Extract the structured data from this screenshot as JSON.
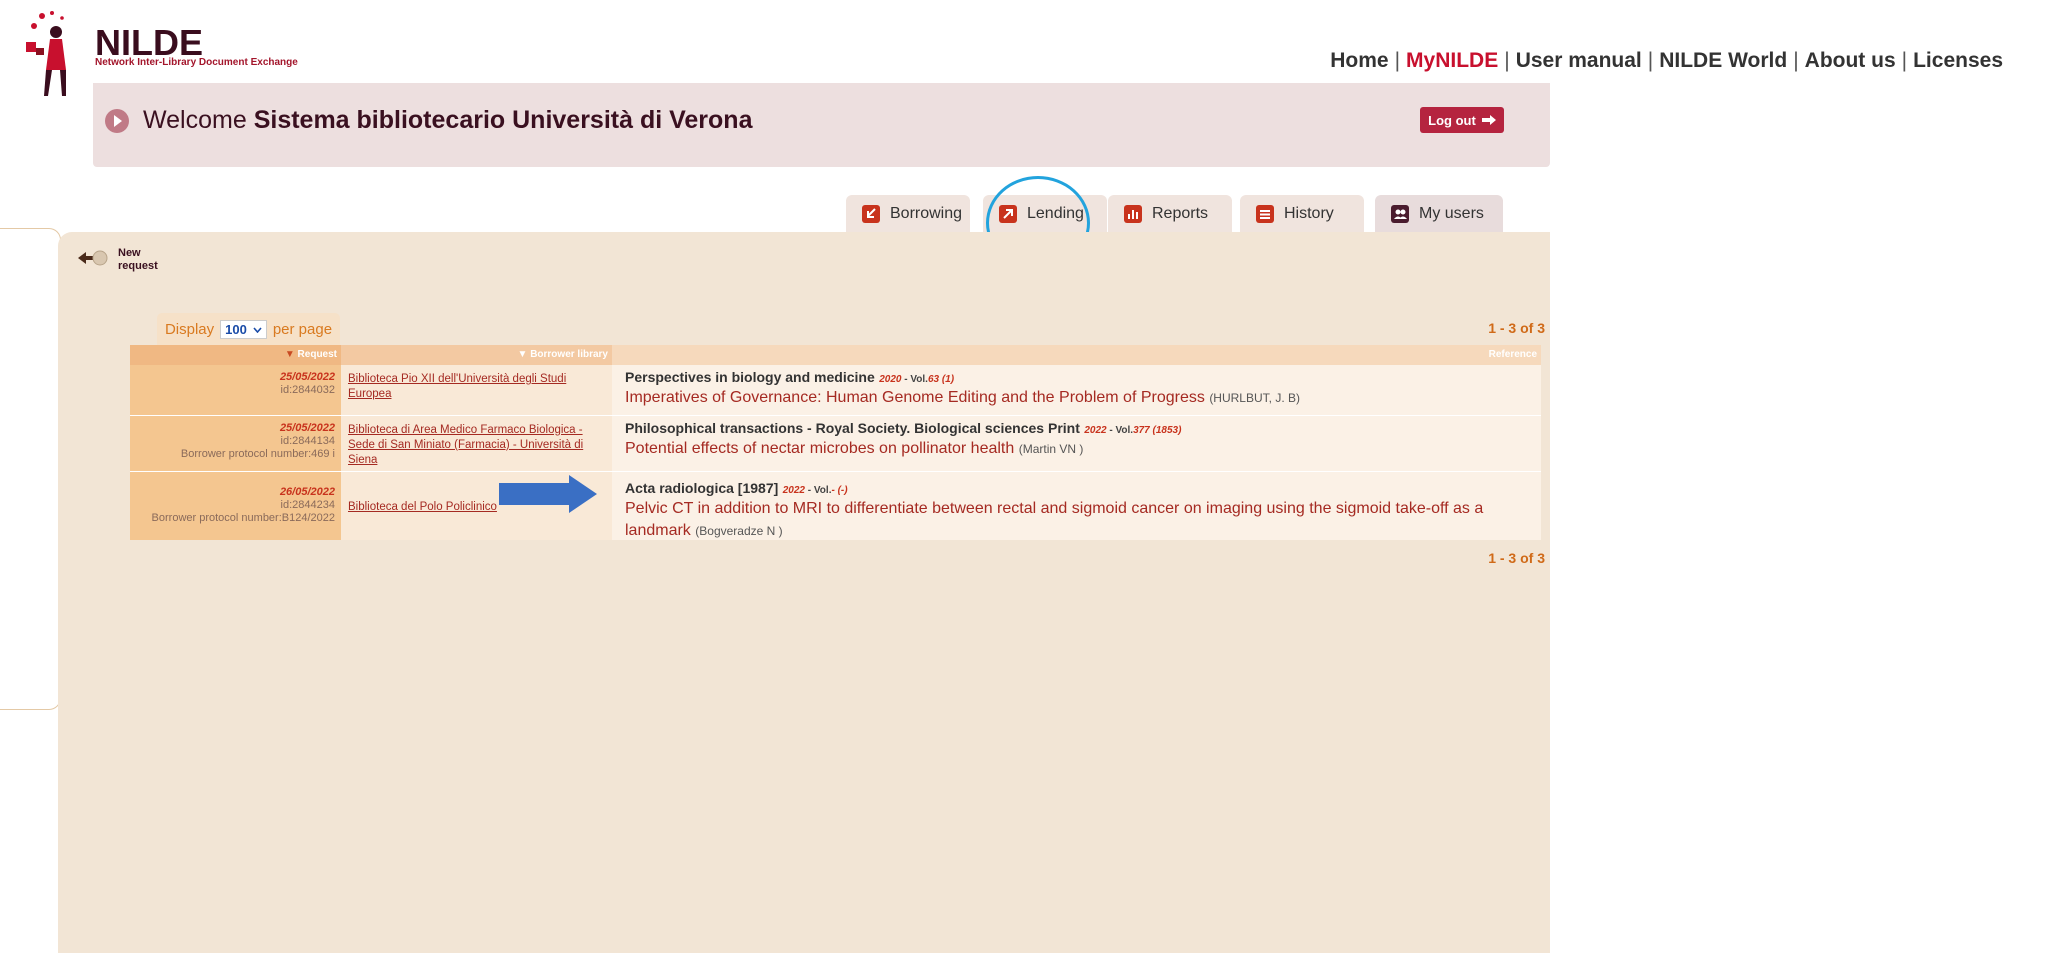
{
  "header": {
    "logo_title": "NILDE",
    "logo_subtitle": "Network Inter-Library Document Exchange",
    "nav": [
      {
        "label": "Home",
        "active": false
      },
      {
        "label": "MyNILDE",
        "active": true
      },
      {
        "label": "User manual",
        "active": false
      },
      {
        "label": "NILDE World",
        "active": false
      },
      {
        "label": "About us",
        "active": false
      },
      {
        "label": "Licenses",
        "active": false
      }
    ],
    "nav_separator": "|"
  },
  "welcome": {
    "prefix": "Welcome",
    "library_name": "Sistema bibliotecario Università di Verona",
    "logout_label": "Log out"
  },
  "tabs": [
    {
      "label": "Borrowing",
      "icon": "borrowing-icon"
    },
    {
      "label": "Lending",
      "icon": "lending-icon",
      "highlighted": true
    },
    {
      "label": "Reports",
      "icon": "reports-icon"
    },
    {
      "label": "History",
      "icon": "history-icon"
    },
    {
      "label": "My users",
      "icon": "my-users-icon"
    }
  ],
  "sidebar": {
    "new_request_label": "New request"
  },
  "list": {
    "display_label": "Display",
    "per_page_value": "100",
    "per_page_label": "per page",
    "pager_top": "1 - 3 of 3",
    "pager_bottom": "1 - 3 of 3",
    "columns": {
      "request": "Request",
      "borrower": "Borrower library",
      "reference": "Reference"
    },
    "rows": [
      {
        "date": "25/05/2022",
        "id": "id:2844032",
        "protocol": "",
        "borrower": "Biblioteca Pio XII dell'Università degli Studi Europea",
        "journal": "Perspectives in biology and medicine",
        "year": "2020",
        "vol_label": "- Vol.",
        "vol": "63 (1)",
        "article": "Imperatives of Governance: Human Genome Editing and the Problem of Progress",
        "author": "(HURLBUT, J. B)"
      },
      {
        "date": "25/05/2022",
        "id": "id:2844134",
        "protocol": "Borrower protocol number:469 i",
        "borrower": "Biblioteca di Area Medico Farmaco Biologica - Sede di San Miniato (Farmacia) - Università di Siena",
        "journal": "Philosophical transactions - Royal Society. Biological sciences Print",
        "year": "2022",
        "vol_label": "- Vol.",
        "vol": "377 (1853)",
        "article": "Potential effects of nectar microbes on pollinator health",
        "author": "(Martin VN )"
      },
      {
        "date": "26/05/2022",
        "id": "id:2844234",
        "protocol": "Borrower protocol number:B124/2022",
        "borrower": "Biblioteca del Polo Policlinico",
        "journal": "Acta radiologica [1987]",
        "year": "2022",
        "vol_label": "- Vol.",
        "vol": "- (-)",
        "article": "Pelvic CT in addition to MRI to differentiate between rectal and sigmoid cancer on imaging using the sigmoid take-off as a landmark",
        "author": "(Bogveradze N )"
      }
    ]
  },
  "colors": {
    "accent": "#c8102e",
    "logout": "#b5243f",
    "highlight_circle": "#22a3dd",
    "arrow": "#3a6fc4"
  }
}
